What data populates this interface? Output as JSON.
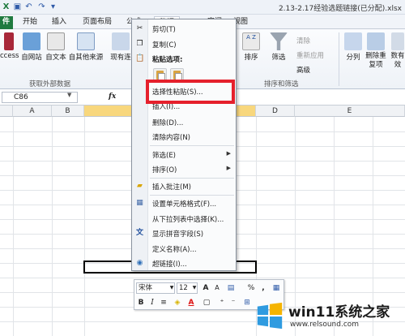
{
  "window": {
    "title": "2.13-2.17经验选题链接(已分配).xlsx"
  },
  "ribbon_tabs": [
    "开始",
    "插入",
    "页面布局",
    "公式",
    "数据",
    "审阅",
    "视图"
  ],
  "ribbon": {
    "external_group_label": "获取外部数据",
    "external_items": [
      "ccess",
      "自网站",
      "自文本",
      "自其他来源",
      "现有连"
    ],
    "sort_items": [
      "排序",
      "筛选"
    ],
    "filter_small": [
      "清除",
      "重新应用",
      "高级"
    ],
    "sort_group_label": "排序和筛选",
    "tools_items": [
      "分列",
      "删除重复项",
      "数有效"
    ]
  },
  "formula_bar": {
    "name_box": "C86",
    "fx": "fx"
  },
  "grid": {
    "columns": [
      "A",
      "B",
      "",
      "D",
      "E"
    ]
  },
  "context_menu": {
    "cut": "剪切(T)",
    "copy": "复制(C)",
    "paste_options": "粘贴选项:",
    "paste_special": "选择性粘贴(S)...",
    "insert": "插入(I)...",
    "delete": "删除(D)...",
    "clear": "清除内容(N)",
    "filter": "筛选(E)",
    "sort": "排序(O)",
    "insert_comment": "插入批注(M)",
    "format_cells": "设置单元格格式(F)...",
    "pick_from_list": "从下拉列表中选择(K)...",
    "phonetic": "显示拼音字段(S)",
    "define_name": "定义名称(A)...",
    "hyperlink": "超链接(I)..."
  },
  "mini_toolbar": {
    "font": "宋体",
    "size": "12",
    "grow": "A",
    "shrink": "A",
    "percent": "%",
    "comma": ",",
    "bold": "B",
    "italic": "I",
    "font_color": "A"
  },
  "watermark": {
    "title": "win11系统之家",
    "url": "www.relsound.com"
  },
  "colors": {
    "file_tab": "#1f7a3f",
    "highlight_box": "#e5202c",
    "selected_column": "#f8d77d"
  }
}
